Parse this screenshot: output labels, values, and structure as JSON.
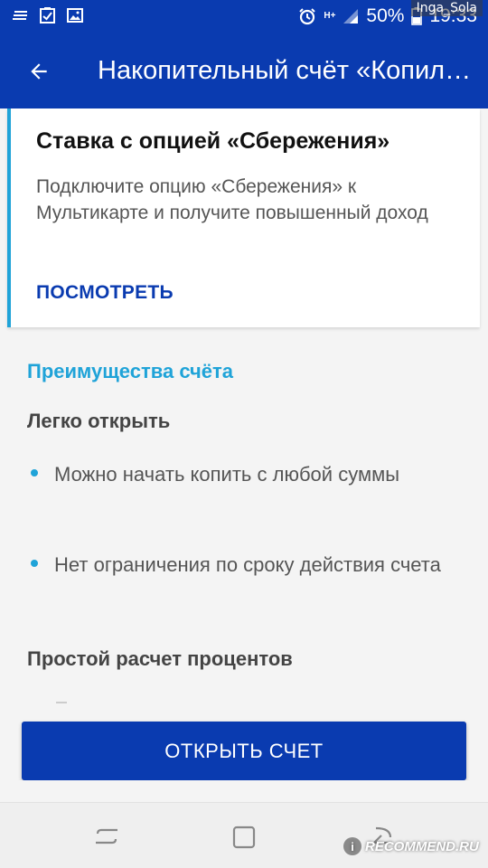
{
  "status_bar": {
    "battery": "50%",
    "time": "19:33",
    "network": "H+",
    "user_watermark": "Inga_Sola"
  },
  "app_bar": {
    "title": "Накопительный счёт «Копилка»"
  },
  "promo": {
    "title": "Ставка с опцией «Сбережения»",
    "description": "Подключите опцию «Сбережения» к Мультикарте и получите повышенный доход",
    "link": "ПОСМОТРЕТЬ"
  },
  "advantages": {
    "title": "Преимущества счёта",
    "easy_open": {
      "heading": "Легко открыть",
      "items": [
        "Можно начать копить с любой суммы",
        "Нет ограничения по сроку действия счета"
      ]
    },
    "simple_calc": {
      "heading": "Простой расчет процентов"
    }
  },
  "action": {
    "open_label": "ОТКРЫТЬ СЧЕТ"
  },
  "site_watermark": "RECOMMEND.RU",
  "colors": {
    "primary": "#0a3bb0",
    "accent": "#1fa3d8"
  }
}
